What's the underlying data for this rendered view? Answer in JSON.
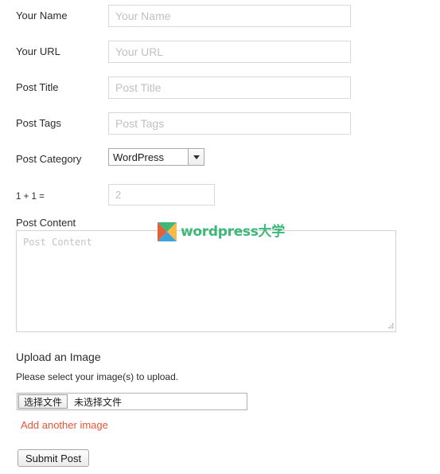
{
  "form": {
    "fields": [
      {
        "label": "Your Name",
        "placeholder": "Your Name",
        "value": ""
      },
      {
        "label": "Your URL",
        "placeholder": "Your URL",
        "value": ""
      },
      {
        "label": "Post Title",
        "placeholder": "Post Title",
        "value": ""
      },
      {
        "label": "Post Tags",
        "placeholder": "Post Tags",
        "value": ""
      }
    ],
    "category": {
      "label": "Post Category",
      "selected": "WordPress",
      "options": [
        "WordPress"
      ]
    },
    "captcha": {
      "label": "1 + 1 =",
      "placeholder": "2",
      "value": ""
    },
    "content": {
      "label": "Post Content",
      "placeholder": "Post Content",
      "value": ""
    }
  },
  "watermark": {
    "text": "wordpress大学",
    "logo_colors": {
      "top": "#3cb878",
      "left": "#e1613c",
      "right": "#f9b949",
      "bottom": "#3aa3dc"
    },
    "text_color": "#3cb878"
  },
  "upload": {
    "title": "Upload an Image",
    "note": "Please select your image(s) to upload.",
    "file_button_label": "选择文件",
    "file_status": "未选择文件",
    "add_another_label": "Add another image",
    "add_another_color": "#e8543a"
  },
  "submit": {
    "label": "Submit Post"
  }
}
